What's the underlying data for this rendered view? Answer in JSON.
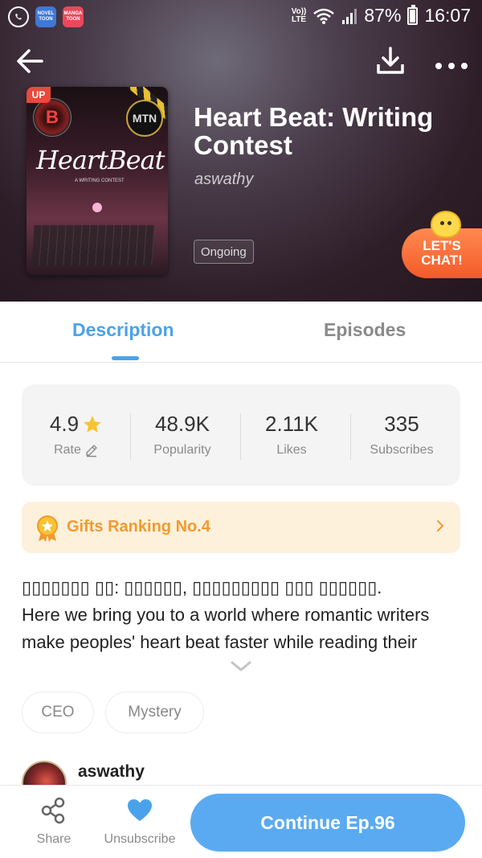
{
  "statusbar": {
    "apps": [
      {
        "icon": "whatsapp-icon"
      },
      {
        "icon": "novel-toon-icon",
        "label": "NOVEL TOON",
        "color": "#3f78d8"
      },
      {
        "icon": "manga-toon-icon",
        "label": "MANGA TOON",
        "color": "#e84a5c"
      }
    ],
    "volte": "Vo)) LTE",
    "battery": "87%",
    "battery_level": 0.87,
    "time": "16:07"
  },
  "header": {
    "back_icon": "back-arrow-icon",
    "download_icon": "download-icon",
    "more_icon": "more-dots-icon"
  },
  "book": {
    "cover": {
      "badge": "UP",
      "logo_letter": "B",
      "mtn": "MTN",
      "title": "HeartBeat",
      "subtitle": "A WRITING CONTEST"
    },
    "title": "Heart Beat: Writing Contest",
    "author": "aswathy",
    "status": "Ongoing"
  },
  "chat": {
    "line1": "LET'S",
    "line2": "CHAT!"
  },
  "tabs": {
    "description": "Description",
    "episodes": "Episodes",
    "active": "description"
  },
  "stats": {
    "rate": {
      "value": "4.9",
      "label": "Rate"
    },
    "popularity": {
      "value": "48.9K",
      "label": "Popularity"
    },
    "likes": {
      "value": "2.11K",
      "label": "Likes"
    },
    "subscribes": {
      "value": "335",
      "label": "Subscribes"
    }
  },
  "gifts": {
    "label": "Gifts Ranking No.4"
  },
  "description": {
    "line1": "▯▯▯▯▯▯▯ ▯▯: ▯▯▯▯▯▯, ▯▯▯▯▯▯▯▯▯ ▯▯▯ ▯▯▯▯▯▯.",
    "line2": "Here we bring you to a world where romantic writers",
    "line3": "make peoples' heart beat faster while reading their"
  },
  "tags": [
    "CEO",
    "Mystery"
  ],
  "author_section": {
    "name": "aswathy"
  },
  "bottom": {
    "share": "Share",
    "unsubscribe": "Unsubscribe",
    "continue": "Continue Ep.96"
  },
  "colors": {
    "accent": "#4aa3ea",
    "button": "#5aaaf2",
    "gift_text": "#f29a2e",
    "gift_bg": "#fdf1dc",
    "star": "#f7c331",
    "chat": "#f45a2a"
  }
}
